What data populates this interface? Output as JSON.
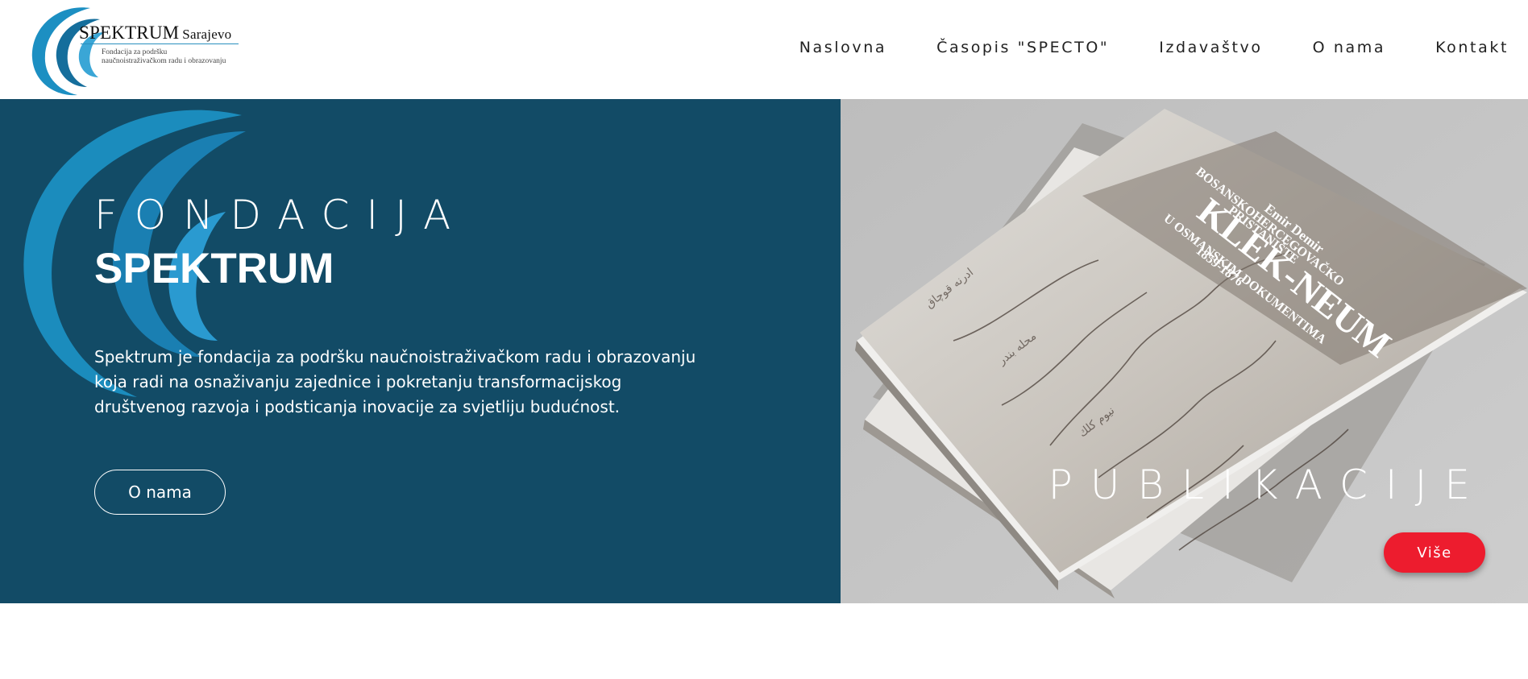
{
  "brand": {
    "name": "SPEKTRUM",
    "city": "Sarajevo",
    "subtitle_line1": "Fondacija za podršku",
    "subtitle_line2": "naučnoistraživačkom radu i obrazovanju",
    "logo_colors": [
      "#1c8fc2",
      "#156e9c",
      "#3aa6d6"
    ]
  },
  "nav": {
    "items": [
      {
        "label": "Naslovna"
      },
      {
        "label": "Časopis \"SPECTO\""
      },
      {
        "label": "Izdavaštvo"
      },
      {
        "label": "O nama"
      },
      {
        "label": "Kontakt"
      }
    ]
  },
  "hero": {
    "background": "#124b66",
    "kicker": "FONDACIJA",
    "title": "SPEKTRUM",
    "description": "Spektrum je fondacija za podršku naučnoistraživačkom radu i obrazovanju koja radi na osnaživanju zajednice i pokretanju transformacijskog društvenog razvoja i podsticanja inovacije za svjetliju budućnost.",
    "button_label": "O nama"
  },
  "publications": {
    "title": "PUBLIKACIJE",
    "button_label": "Više",
    "button_color": "#ed1c2e",
    "book": {
      "author": "Emir Demir",
      "heading_line1": "BOSANSKOHERCEGOVAČKO",
      "heading_line2": "PRISTANIŠTE",
      "title": "KLEK-NEUM",
      "subtitle": "U OSMANSKIM DOKUMENTIMA",
      "years": "1859-1876"
    }
  }
}
